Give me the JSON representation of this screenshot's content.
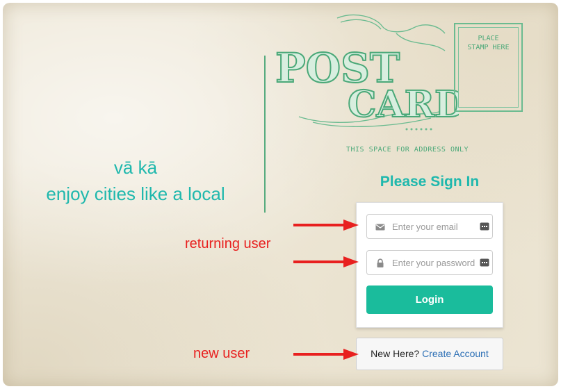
{
  "tagline": {
    "line1": "vā kā",
    "line2": "enjoy cities like a local"
  },
  "postcard": {
    "logo_word1": "POST",
    "logo_word2": "CARD",
    "stamp_line1": "PLACE",
    "stamp_line2": "STAMP HERE",
    "address_line": "THIS SPACE FOR ADDRESS ONLY"
  },
  "login": {
    "title": "Please Sign In",
    "email_placeholder": "Enter your email",
    "password_placeholder": "Enter your password",
    "button": "Login"
  },
  "signup": {
    "prompt": "New Here?",
    "link": "Create Account"
  },
  "annotations": {
    "returning": "returning user",
    "new": "new user"
  },
  "icons": {
    "email": "envelope-icon",
    "password": "lock-icon",
    "autofill": "keyboard-icon",
    "arrow": "red-arrow"
  },
  "colors": {
    "accent": "#1fb8ad",
    "button": "#1abc9c",
    "postcard_ink": "#4aa878",
    "annotation": "#e8201f",
    "link": "#2c6fb5"
  }
}
